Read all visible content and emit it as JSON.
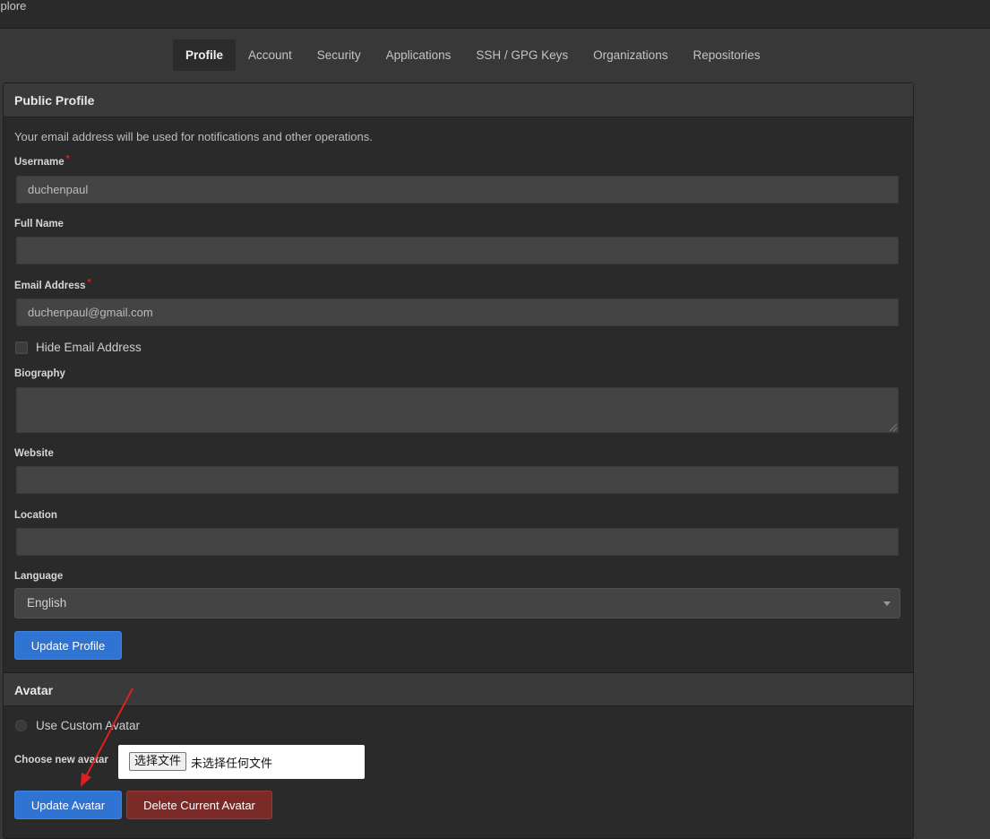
{
  "topbar": {
    "crumb": "xplore"
  },
  "tabs": [
    {
      "label": "Profile"
    },
    {
      "label": "Account"
    },
    {
      "label": "Security"
    },
    {
      "label": "Applications"
    },
    {
      "label": "SSH / GPG Keys"
    },
    {
      "label": "Organizations"
    },
    {
      "label": "Repositories"
    }
  ],
  "profile": {
    "title": "Public Profile",
    "hint": "Your email address will be used for notifications and other operations.",
    "username": {
      "label": "Username",
      "value": "duchenpaul"
    },
    "full_name": {
      "label": "Full Name",
      "value": ""
    },
    "email": {
      "label": "Email Address",
      "value": "duchenpaul@gmail.com"
    },
    "hide_email": {
      "label": "Hide Email Address",
      "checked": false
    },
    "biography": {
      "label": "Biography",
      "value": ""
    },
    "website": {
      "label": "Website",
      "value": ""
    },
    "location": {
      "label": "Location",
      "value": ""
    },
    "language": {
      "label": "Language",
      "value": "English"
    },
    "update_button": "Update Profile"
  },
  "avatar": {
    "title": "Avatar",
    "use_custom": {
      "label": "Use Custom Avatar",
      "checked": false
    },
    "choose_label": "Choose new avatar",
    "file_button": "选择文件",
    "file_status": "未选择任何文件",
    "update_button": "Update Avatar",
    "delete_button": "Delete Current Avatar"
  },
  "colors": {
    "primary": "#2f73d3",
    "danger": "#7c2a28",
    "annotation_arrow": "#e02020"
  }
}
